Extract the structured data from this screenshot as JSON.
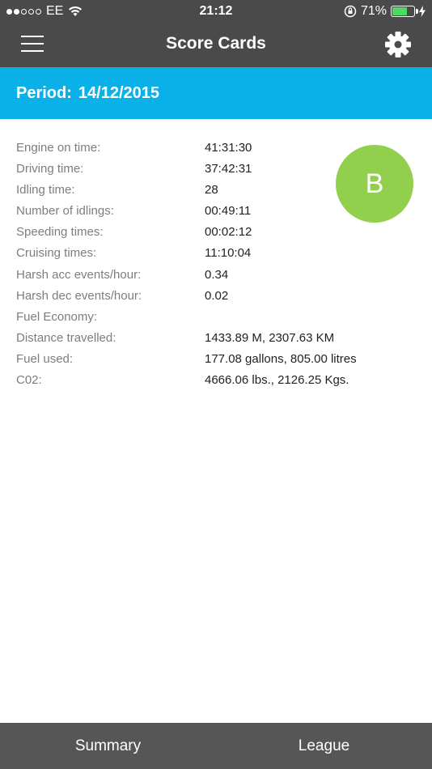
{
  "status_bar": {
    "carrier": "EE",
    "time": "21:12",
    "battery_percent": "71%",
    "battery_level": 0.71,
    "signal_bars_filled": 2,
    "signal_bars_total": 5
  },
  "header": {
    "title": "Score Cards",
    "menu_icon": "hamburger-menu-icon",
    "settings_icon": "gear-icon"
  },
  "period": {
    "label": "Period:",
    "date": "14/12/2015"
  },
  "grade": "B",
  "colors": {
    "header_bg": "#4a4a4a",
    "period_bg": "#0ab0e8",
    "grade_bg": "#92cf4c",
    "tab_bar_bg": "#565656",
    "battery_fill": "#4cd964"
  },
  "metrics": [
    {
      "label": "Engine on time:",
      "value": "41:31:30"
    },
    {
      "label": "Driving time:",
      "value": "37:42:31"
    },
    {
      "label": "Idling time:",
      "value": "28"
    },
    {
      "label": "Number of idlings:",
      "value": "00:49:11"
    },
    {
      "label": "Speeding times:",
      "value": "00:02:12"
    },
    {
      "label": "Cruising times:",
      "value": "11:10:04"
    },
    {
      "label": "Harsh acc events/hour:",
      "value": "0.34"
    },
    {
      "label": "Harsh dec events/hour:",
      "value": "0.02"
    },
    {
      "label": "Fuel Economy:",
      "value": ""
    },
    {
      "label": "Distance travelled:",
      "value": "1433.89 M, 2307.63 KM"
    },
    {
      "label": "Fuel used:",
      "value": "177.08 gallons, 805.00 litres"
    },
    {
      "label": "C02:",
      "value": "4666.06 lbs., 2126.25 Kgs."
    }
  ],
  "tabs": [
    {
      "label": "Summary"
    },
    {
      "label": "League"
    }
  ]
}
